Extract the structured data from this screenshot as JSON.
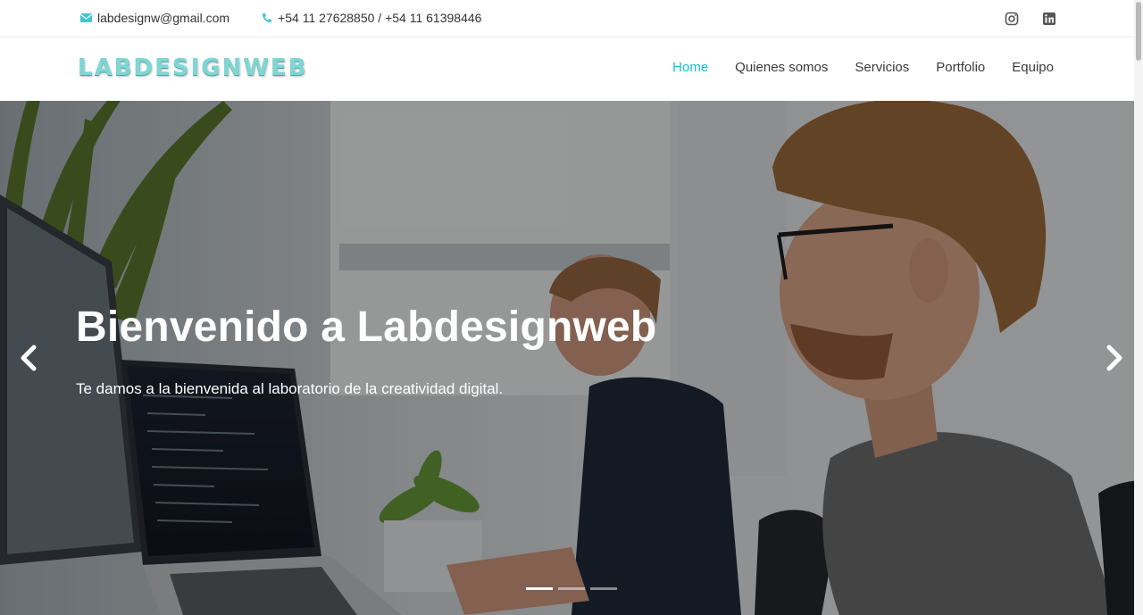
{
  "topbar": {
    "email": "labdesignw@gmail.com",
    "phone": "+54 11 27628850 / +54 11 61398446",
    "social": [
      "instagram-icon",
      "linkedin-icon"
    ]
  },
  "brand": {
    "logo_text": "LABDESIGNWEB"
  },
  "nav": {
    "items": [
      {
        "label": "Home",
        "active": true
      },
      {
        "label": "Quienes somos"
      },
      {
        "label": "Servicios"
      },
      {
        "label": "Portfolio"
      },
      {
        "label": "Equipo"
      }
    ]
  },
  "hero": {
    "title": "Bienvenido a Labdesignweb",
    "subtitle": "Te damos a la bienvenida al laboratorio de la creatividad digital.",
    "slides_total": 3,
    "active_slide": 1
  },
  "colors": {
    "accent": "#1bbdd4",
    "logo": "#7fd6d3"
  }
}
